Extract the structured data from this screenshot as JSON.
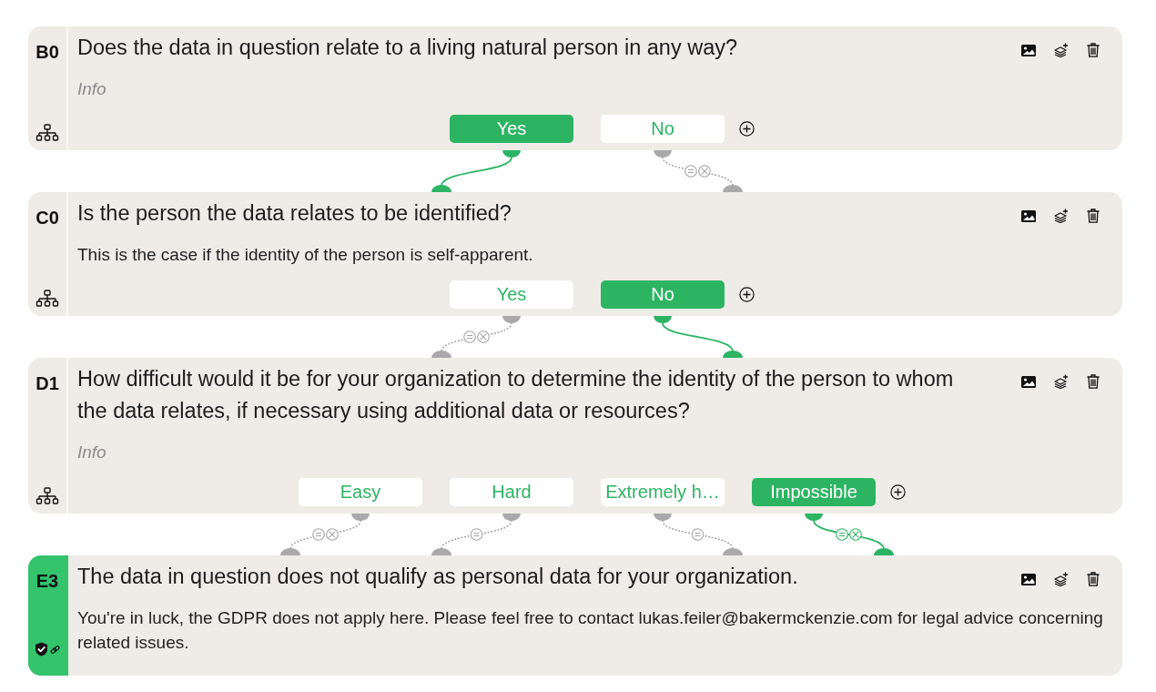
{
  "cards": [
    {
      "kind": "question",
      "label": "B0",
      "title": "Does the data in question relate to a living natural person in any way?",
      "description": {
        "placeholder": "Info"
      },
      "answers": [
        {
          "label": "Yes",
          "selected": true
        },
        {
          "label": "No",
          "selected": false,
          "badges": [
            {
              "kind": "equals"
            },
            {
              "kind": "cross"
            }
          ]
        }
      ]
    },
    {
      "kind": "question",
      "label": "C0",
      "title": "Is the person the data relates to be identified?",
      "description": {
        "value": "This is the case if the identity of the person is self-apparent."
      },
      "answers": [
        {
          "label": "Yes",
          "selected": false,
          "badges": [
            {
              "kind": "equals"
            },
            {
              "kind": "cross"
            }
          ]
        },
        {
          "label": "No",
          "selected": true
        }
      ]
    },
    {
      "kind": "question",
      "label": "D1",
      "title": "How difficult would it be for your organization to determine the identity of the person to whom the data relates, if necessary using additional data or resources?",
      "description": {
        "placeholder": "Info"
      },
      "answers": [
        {
          "label": "Easy",
          "selected": false,
          "badges": [
            {
              "kind": "equals"
            },
            {
              "kind": "cross"
            }
          ]
        },
        {
          "label": "Hard",
          "selected": false,
          "badges": [
            {
              "kind": "equals"
            }
          ]
        },
        {
          "label": "Extremely h…",
          "selected": false,
          "badges": [
            {
              "kind": "equals"
            }
          ]
        },
        {
          "label": "Impossible",
          "selected": true,
          "badges": [
            {
              "kind": "equals"
            },
            {
              "kind": "cross"
            }
          ]
        }
      ]
    },
    {
      "kind": "outcome",
      "label": "E3",
      "title": "The data in question does not qualify as personal data for your organization.",
      "description": {
        "value": "You're in luck, the GDPR does not apply here. Please feel free to contact lukas.feiler@bakermckenzie.com for legal advice concerning related issues."
      }
    }
  ]
}
